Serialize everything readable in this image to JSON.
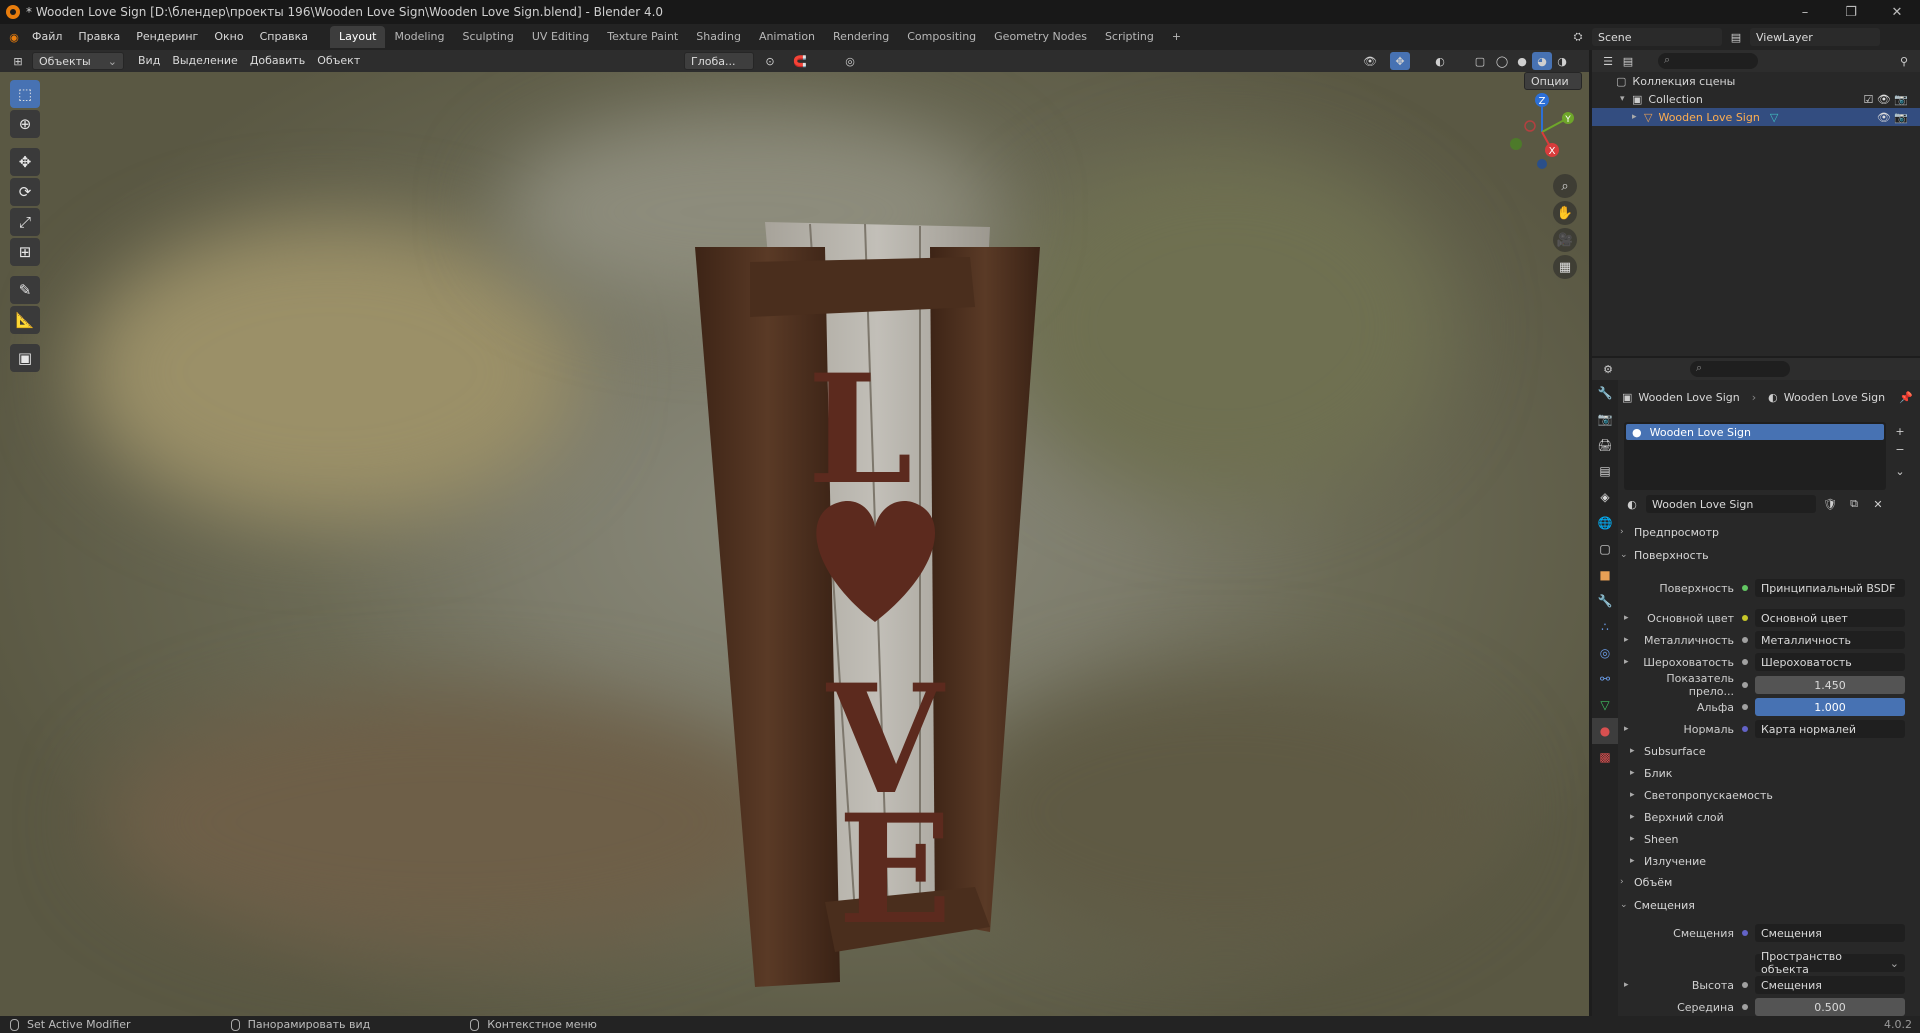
{
  "window": {
    "title": "* Wooden Love Sign [D:\\блендер\\проекты 196\\Wooden Love Sign\\Wooden Love Sign.blend] - Blender 4.0",
    "controls": [
      "–",
      "❐",
      "✕"
    ]
  },
  "menubar": {
    "menus": [
      "Файл",
      "Правка",
      "Рендеринг",
      "Окно",
      "Справка"
    ],
    "workspaces": [
      "Layout",
      "Modeling",
      "Sculpting",
      "UV Editing",
      "Texture Paint",
      "Shading",
      "Animation",
      "Rendering",
      "Compositing",
      "Geometry Nodes",
      "Scripting"
    ],
    "active_workspace": "Layout",
    "add_tab": "+",
    "scene": "Scene",
    "view_layer": "ViewLayer"
  },
  "viewport_header": {
    "mode": "Объекты",
    "menus": [
      "Вид",
      "Выделение",
      "Добавить",
      "Объект"
    ],
    "transform_orientation": "Глоба...",
    "options": "Опции"
  },
  "artwork": {
    "letters": [
      "L",
      "V",
      "E"
    ]
  },
  "gizmo": {
    "z": "Z",
    "y": "Y",
    "x": "X"
  },
  "outliner": {
    "root": "Коллекция сцены",
    "collection": "Collection",
    "object": "Wooden Love Sign"
  },
  "properties": {
    "breadcrumb": [
      "Wooden Love Sign",
      "Wooden Love Sign"
    ],
    "material_slot": "Wooden Love Sign",
    "material_name": "Wooden Love Sign",
    "sections": {
      "preview": "Предпросмотр",
      "surface": "Поверхность",
      "volume": "Объём",
      "displacement": "Смещения"
    },
    "surface_rows": [
      {
        "label": "Поверхность",
        "value": "Принципиальный BSDF",
        "dot": "#63c763",
        "kind": "link",
        "expand": false
      },
      {
        "label": "Основной цвет",
        "value": "Основной цвет",
        "dot": "#c7c729",
        "kind": "link",
        "expand": true
      },
      {
        "label": "Металличность",
        "value": "Металличность",
        "dot": "#a1a1a1",
        "kind": "link",
        "expand": true
      },
      {
        "label": "Шероховатость",
        "value": "Шероховатость",
        "dot": "#a1a1a1",
        "kind": "link",
        "expand": true
      },
      {
        "label": "Показатель прело...",
        "value": "1.450",
        "dot": "#a1a1a1",
        "kind": "num",
        "expand": false
      },
      {
        "label": "Альфа",
        "value": "1.000",
        "dot": "#a1a1a1",
        "kind": "blue",
        "expand": false
      },
      {
        "label": "Нормаль",
        "value": "Карта нормалей",
        "dot": "#6363c7",
        "kind": "link",
        "expand": true
      }
    ],
    "sub_panels": [
      "Subsurface",
      "Блик",
      "Светопропускаемость",
      "Верхний слой",
      "Sheen",
      "Излучение"
    ],
    "displacement_rows": [
      {
        "label": "Смещения",
        "value": "Смещения",
        "dot": "#6363c7",
        "kind": "link",
        "expand": false
      },
      {
        "label": "",
        "value": "Пространство объекта",
        "dot": "",
        "kind": "dropdown",
        "expand": false
      },
      {
        "label": "Высота",
        "value": "Смещения",
        "dot": "#a1a1a1",
        "kind": "link",
        "expand": true
      },
      {
        "label": "Середина",
        "value": "0.500",
        "dot": "#a1a1a1",
        "kind": "num",
        "expand": false
      }
    ]
  },
  "statusbar": {
    "items": [
      "Set Active Modifier",
      "Панорамировать вид",
      "Контекстное меню"
    ],
    "version": "4.0.2"
  }
}
